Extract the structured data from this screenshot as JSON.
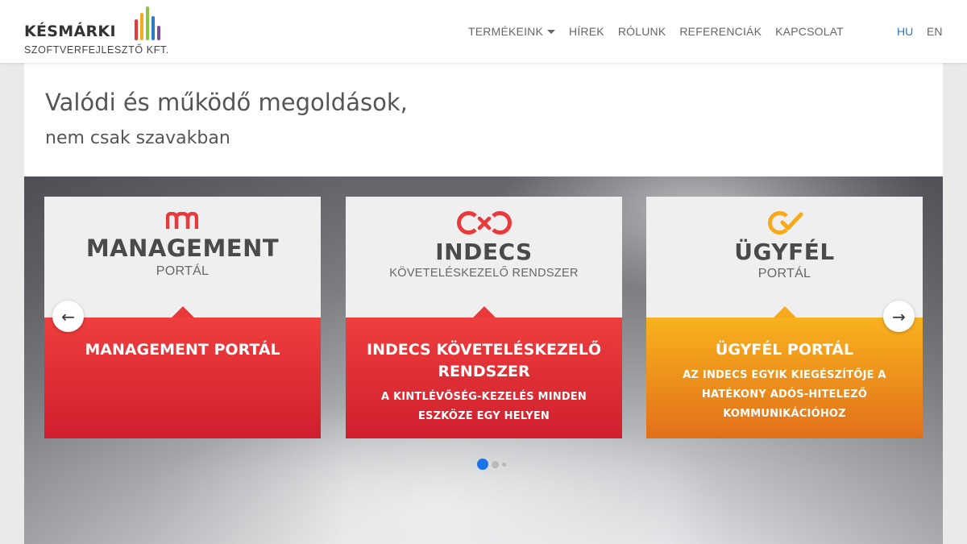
{
  "header": {
    "logo_name": "KÉSMÁRKI",
    "logo_sub": "SZOFTVERFEJLESZTŐ KFT.",
    "logo_bar_colors": [
      "#e8393b",
      "#f6a91a",
      "#8cc63f",
      "#2a7dc4",
      "#7b4ea0"
    ],
    "nav": [
      {
        "label": "TERMÉKEINK",
        "dropdown": true
      },
      {
        "label": "HÍREK"
      },
      {
        "label": "RÓLUNK"
      },
      {
        "label": "REFERENCIÁK"
      },
      {
        "label": "KAPCSOLAT"
      }
    ],
    "languages": [
      {
        "label": "HU",
        "active": true
      },
      {
        "label": "EN",
        "active": false
      }
    ]
  },
  "hero": {
    "headline": "Valódi és működő megoldások,",
    "subline": "nem csak szavakban"
  },
  "slider": {
    "prev_icon": "arrow-left-icon",
    "next_icon": "arrow-right-icon",
    "active_dot": 1,
    "dot_count": 3,
    "cards": [
      {
        "logo_icon": "management-logo-icon",
        "brand": "MANAGEMENT",
        "brand_sub": "PORTÁL",
        "title": "MANAGEMENT PORTÁL",
        "desc": "",
        "color": "red"
      },
      {
        "logo_icon": "indecs-logo-icon",
        "brand": "INDECS",
        "brand_sub": "KÖVETELÉSKEZELŐ RENDSZER",
        "title": "INDECS KÖVETELÉSKEZELŐ RENDSZER",
        "desc": "A KINTLÉVŐSÉG-KEZELÉS MINDEN ESZKÖZE EGY HELYEN",
        "color": "red"
      },
      {
        "logo_icon": "ugyfel-logo-icon",
        "brand": "ÜGYFÉL",
        "brand_sub": "PORTÁL",
        "title": "ÜGYFÉL PORTÁL",
        "desc": "AZ INDECS EGYIK KIEGÉSZÍTŐJE A HATÉKONY ADÓS-HITELEZŐ KOMMUNIKÁCIÓHOZ",
        "color": "orange"
      }
    ],
    "colors": {
      "red_top": "#ee3e3d",
      "red_bottom": "#cf1f2e",
      "orange_top": "#f8b21d",
      "orange_bottom": "#e2701b",
      "dot_active": "#1a73e8"
    }
  }
}
